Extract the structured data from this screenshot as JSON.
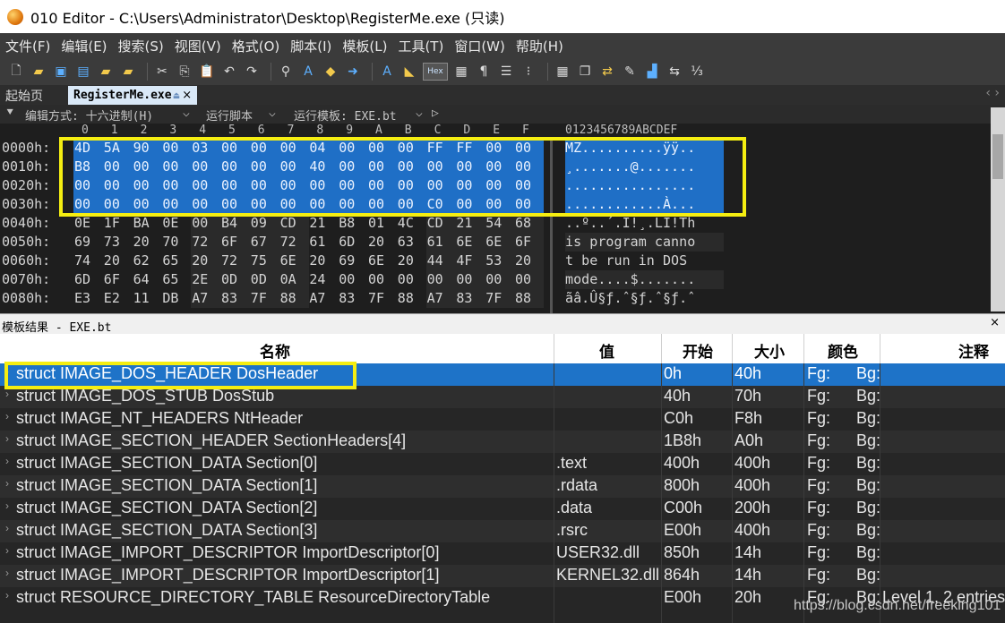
{
  "window": {
    "title": "010 Editor - C:\\Users\\Administrator\\Desktop\\RegisterMe.exe (只读)"
  },
  "menu": [
    "文件(F)",
    "编辑(E)",
    "搜索(S)",
    "视图(V)",
    "格式(O)",
    "脚本(I)",
    "模板(L)",
    "工具(T)",
    "窗口(W)",
    "帮助(H)"
  ],
  "tabs": {
    "start": "起始页",
    "active": "RegisterMe.exe",
    "close": "×",
    "nav": "‹ ›"
  },
  "editor_bar": {
    "edit_mode": "编辑方式: 十六进制(H)",
    "run_script": "运行脚本",
    "run_template": "运行模板: EXE.bt",
    "play": "▷"
  },
  "hex": {
    "col_headers": [
      "0",
      "1",
      "2",
      "3",
      "4",
      "5",
      "6",
      "7",
      "8",
      "9",
      "A",
      "B",
      "C",
      "D",
      "E",
      "F"
    ],
    "ascii_header": "0123456789ABCDEF",
    "rows": [
      {
        "addr": "0000h:",
        "bytes": [
          "4D",
          "5A",
          "90",
          "00",
          "03",
          "00",
          "00",
          "00",
          "04",
          "00",
          "00",
          "00",
          "FF",
          "FF",
          "00",
          "00"
        ],
        "ascii": "MZ..........ÿÿ.."
      },
      {
        "addr": "0010h:",
        "bytes": [
          "B8",
          "00",
          "00",
          "00",
          "00",
          "00",
          "00",
          "00",
          "40",
          "00",
          "00",
          "00",
          "00",
          "00",
          "00",
          "00"
        ],
        "ascii": "¸.......@......."
      },
      {
        "addr": "0020h:",
        "bytes": [
          "00",
          "00",
          "00",
          "00",
          "00",
          "00",
          "00",
          "00",
          "00",
          "00",
          "00",
          "00",
          "00",
          "00",
          "00",
          "00"
        ],
        "ascii": "................"
      },
      {
        "addr": "0030h:",
        "bytes": [
          "00",
          "00",
          "00",
          "00",
          "00",
          "00",
          "00",
          "00",
          "00",
          "00",
          "00",
          "00",
          "C0",
          "00",
          "00",
          "00"
        ],
        "ascii": "............À..."
      },
      {
        "addr": "0040h:",
        "bytes": [
          "0E",
          "1F",
          "BA",
          "0E",
          "00",
          "B4",
          "09",
          "CD",
          "21",
          "B8",
          "01",
          "4C",
          "CD",
          "21",
          "54",
          "68"
        ],
        "ascii": "..º..´.Í!¸.LÍ!Th"
      },
      {
        "addr": "0050h:",
        "bytes": [
          "69",
          "73",
          "20",
          "70",
          "72",
          "6F",
          "67",
          "72",
          "61",
          "6D",
          "20",
          "63",
          "61",
          "6E",
          "6E",
          "6F"
        ],
        "ascii": "is program canno"
      },
      {
        "addr": "0060h:",
        "bytes": [
          "74",
          "20",
          "62",
          "65",
          "20",
          "72",
          "75",
          "6E",
          "20",
          "69",
          "6E",
          "20",
          "44",
          "4F",
          "53",
          "20"
        ],
        "ascii": "t be run in DOS "
      },
      {
        "addr": "0070h:",
        "bytes": [
          "6D",
          "6F",
          "64",
          "65",
          "2E",
          "0D",
          "0D",
          "0A",
          "24",
          "00",
          "00",
          "00",
          "00",
          "00",
          "00",
          "00"
        ],
        "ascii": "mode....$......."
      },
      {
        "addr": "0080h:",
        "bytes": [
          "E3",
          "E2",
          "11",
          "DB",
          "A7",
          "83",
          "7F",
          "88",
          "A7",
          "83",
          "7F",
          "88",
          "A7",
          "83",
          "7F",
          "88"
        ],
        "ascii": "ãâ.Û§ƒ.ˆ§ƒ.ˆ§ƒ.ˆ"
      }
    ]
  },
  "template_panel": {
    "label": "模板结果 - EXE.bt",
    "close": "×",
    "columns": {
      "name": "名称",
      "value": "值",
      "start": "开始",
      "size": "大小",
      "color": "颜色",
      "comment": "注释"
    },
    "rows": [
      {
        "name": "struct IMAGE_DOS_HEADER DosHeader",
        "value": "",
        "start": "0h",
        "size": "40h",
        "fg": "Fg:",
        "bg": "Bg:",
        "comment": ""
      },
      {
        "name": "struct IMAGE_DOS_STUB DosStub",
        "value": "",
        "start": "40h",
        "size": "70h",
        "fg": "Fg:",
        "bg": "Bg:",
        "comment": ""
      },
      {
        "name": "struct IMAGE_NT_HEADERS NtHeader",
        "value": "",
        "start": "C0h",
        "size": "F8h",
        "fg": "Fg:",
        "bg": "Bg:",
        "comment": ""
      },
      {
        "name": "struct IMAGE_SECTION_HEADER SectionHeaders[4]",
        "value": "",
        "start": "1B8h",
        "size": "A0h",
        "fg": "Fg:",
        "bg": "Bg:",
        "comment": ""
      },
      {
        "name": "struct IMAGE_SECTION_DATA Section[0]",
        "value": ".text",
        "start": "400h",
        "size": "400h",
        "fg": "Fg:",
        "bg": "Bg:",
        "comment": ""
      },
      {
        "name": "struct IMAGE_SECTION_DATA Section[1]",
        "value": ".rdata",
        "start": "800h",
        "size": "400h",
        "fg": "Fg:",
        "bg": "Bg:",
        "comment": ""
      },
      {
        "name": "struct IMAGE_SECTION_DATA Section[2]",
        "value": ".data",
        "start": "C00h",
        "size": "200h",
        "fg": "Fg:",
        "bg": "Bg:",
        "comment": ""
      },
      {
        "name": "struct IMAGE_SECTION_DATA Section[3]",
        "value": ".rsrc",
        "start": "E00h",
        "size": "400h",
        "fg": "Fg:",
        "bg": "Bg:",
        "comment": ""
      },
      {
        "name": "struct IMAGE_IMPORT_DESCRIPTOR ImportDescriptor[0]",
        "value": "USER32.dll",
        "start": "850h",
        "size": "14h",
        "fg": "Fg:",
        "bg": "Bg:",
        "comment": ""
      },
      {
        "name": "struct IMAGE_IMPORT_DESCRIPTOR ImportDescriptor[1]",
        "value": "KERNEL32.dll",
        "start": "864h",
        "size": "14h",
        "fg": "Fg:",
        "bg": "Bg:",
        "comment": ""
      },
      {
        "name": "struct RESOURCE_DIRECTORY_TABLE ResourceDirectoryTable",
        "value": "",
        "start": "E00h",
        "size": "20h",
        "fg": "Fg:",
        "bg": "Bg:",
        "comment": "Level 1, 2 entries"
      }
    ]
  },
  "watermark": "https://blog.csdn.net/freeking101"
}
